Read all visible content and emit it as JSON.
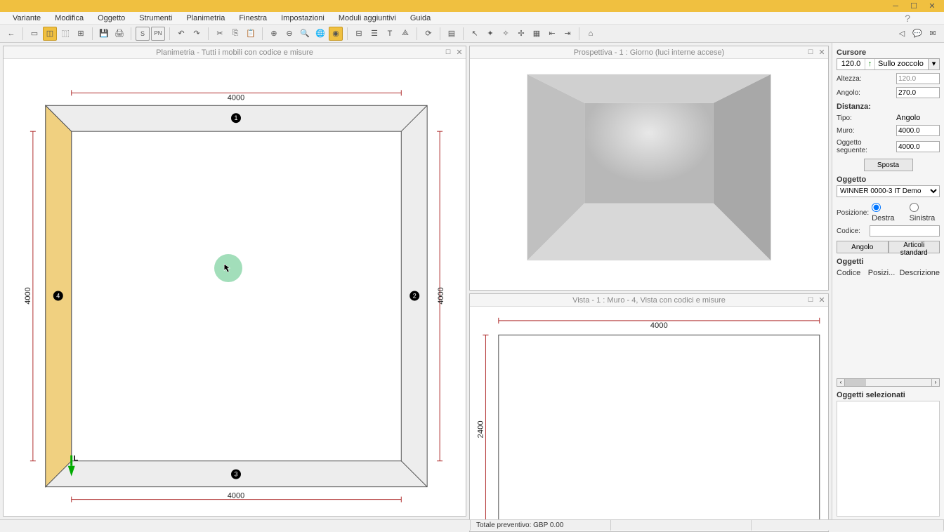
{
  "menubar": {
    "items": [
      "Variante",
      "Modifica",
      "Oggetto",
      "Strumenti",
      "Planimetria",
      "Finestra",
      "Impostazioni",
      "Moduli aggiuntivi",
      "Guida"
    ]
  },
  "panels": {
    "floorplan_title": "Planimetria - Tutti i mobili con codice e misure",
    "perspective_title": "Prospettiva - 1 : Giorno (luci interne accese)",
    "elevation_title": "Vista - 1 : Muro - 4, Vista con codici e misure"
  },
  "floorplan": {
    "dim_top": "4000",
    "dim_bottom": "4000",
    "dim_left": "4000",
    "dim_right": "4000"
  },
  "elevation": {
    "dim_top": "4000",
    "dim_left": "2400"
  },
  "sidebar": {
    "cursore_title": "Cursore",
    "cursor_value": "120.0",
    "cursor_mode": "Sullo zoccolo",
    "altezza_label": "Altezza:",
    "altezza_value": "120.0",
    "angolo_label": "Angolo:",
    "angolo_value": "270.0",
    "distanza_title": "Distanza:",
    "tipo_label": "Tipo:",
    "tipo_angolo": "Angolo",
    "muro_label": "Muro:",
    "muro_value": "4000.0",
    "ogg_seg_label": "Oggetto seguente:",
    "ogg_seg_value": "4000.0",
    "sposta_btn": "Sposta",
    "oggetto_title": "Oggetto",
    "catalog": "WINNER 0000-3 IT Demo",
    "posizione_label": "Posizione:",
    "radio_destra": "Destra",
    "radio_sinistra": "Sinistra",
    "codice_label": "Codice:",
    "angolo_btn": "Angolo",
    "articoli_btn": "Articoli standard",
    "oggetti_title": "Oggetti",
    "col_codice": "Codice",
    "col_posizi": "Posizi...",
    "col_descr": "Descrizione",
    "ogg_sel_title": "Oggetti selezionati"
  },
  "statusbar": {
    "totale": "Totale preventivo: GBP 0.00"
  }
}
